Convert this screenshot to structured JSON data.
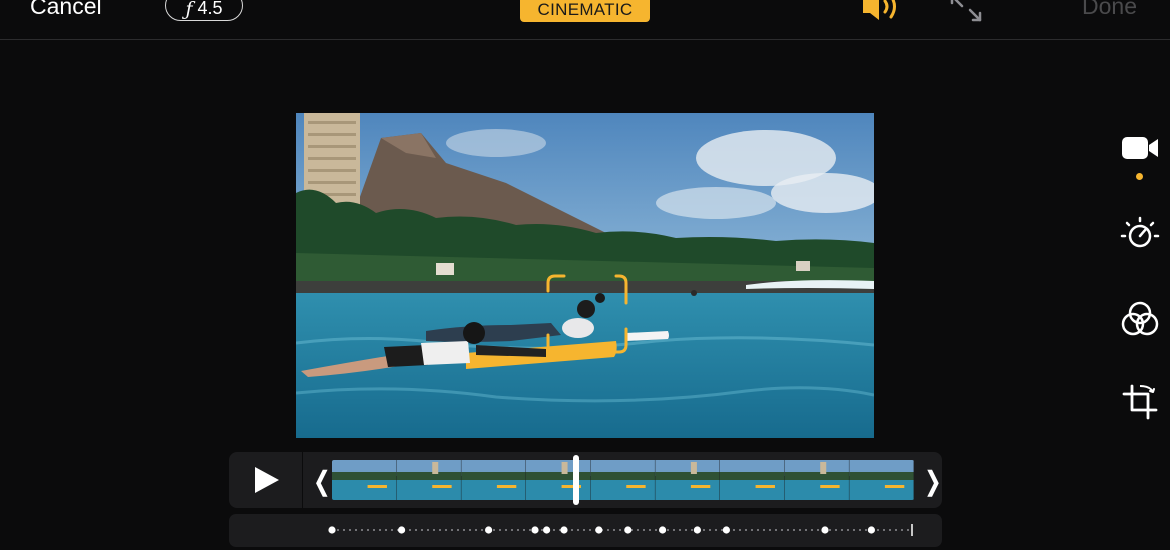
{
  "topbar": {
    "cancel_label": "Cancel",
    "aperture_symbol": "ƒ",
    "aperture_value": "4.5",
    "mode_badge": "CINEMATIC",
    "done_label": "Done",
    "accent_color": "#f6b52f"
  },
  "icons": {
    "speaker": "speaker-wave-icon",
    "expand": "expand-arrows-icon",
    "video": "video-camera-icon",
    "adjust": "adjust-dial-icon",
    "filters": "filters-circles-icon",
    "crop": "crop-rotate-icon",
    "play": "play-icon"
  },
  "tools": [
    {
      "name": "video",
      "selected": true
    },
    {
      "name": "adjust",
      "selected": false
    },
    {
      "name": "filters",
      "selected": false
    },
    {
      "name": "crop",
      "selected": false
    }
  ],
  "timeline": {
    "trim_left_glyph": "❬",
    "trim_right_glyph": "❭",
    "playhead_fraction": 0.42,
    "frame_count": 9
  },
  "focus_track": {
    "keyframe_positions": [
      0.0,
      0.12,
      0.27,
      0.35,
      0.37,
      0.4,
      0.46,
      0.51,
      0.57,
      0.63,
      0.68,
      0.85,
      0.93
    ],
    "end_fraction": 1.0
  }
}
